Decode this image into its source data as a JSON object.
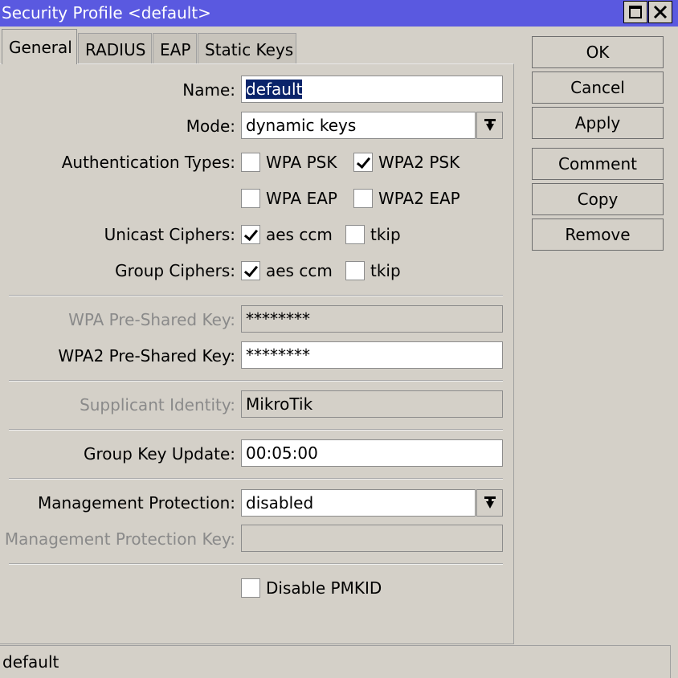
{
  "window": {
    "title": "Security Profile <default>"
  },
  "tabs": [
    {
      "label": "General"
    },
    {
      "label": "RADIUS"
    },
    {
      "label": "EAP"
    },
    {
      "label": "Static Keys"
    }
  ],
  "form": {
    "name": {
      "label": "Name:",
      "value": "default"
    },
    "mode": {
      "label": "Mode:",
      "value": "dynamic keys"
    },
    "auth_types": {
      "label": "Authentication Types:",
      "wpa_psk": {
        "label": "WPA PSK",
        "checked": false
      },
      "wpa2_psk": {
        "label": "WPA2 PSK",
        "checked": true
      },
      "wpa_eap": {
        "label": "WPA EAP",
        "checked": false
      },
      "wpa2_eap": {
        "label": "WPA2 EAP",
        "checked": false
      }
    },
    "unicast": {
      "label": "Unicast Ciphers:",
      "aes": {
        "label": "aes ccm",
        "checked": true
      },
      "tkip": {
        "label": "tkip",
        "checked": false
      }
    },
    "group": {
      "label": "Group Ciphers:",
      "aes": {
        "label": "aes ccm",
        "checked": true
      },
      "tkip": {
        "label": "tkip",
        "checked": false
      }
    },
    "wpa_key": {
      "label": "WPA Pre-Shared Key:",
      "value": "********"
    },
    "wpa2_key": {
      "label": "WPA2 Pre-Shared Key:",
      "value": "********"
    },
    "supplicant": {
      "label": "Supplicant Identity:",
      "value": "MikroTik"
    },
    "group_key_update": {
      "label": "Group Key Update:",
      "value": "00:05:00"
    },
    "mgmt_protection": {
      "label": "Management Protection:",
      "value": "disabled"
    },
    "mgmt_key": {
      "label": "Management Protection Key:",
      "value": ""
    },
    "disable_pmkid": {
      "label": "Disable PMKID",
      "checked": false
    }
  },
  "buttons": {
    "ok": "OK",
    "cancel": "Cancel",
    "apply": "Apply",
    "comment": "Comment",
    "copy": "Copy",
    "remove": "Remove"
  },
  "status": {
    "text": "default"
  }
}
